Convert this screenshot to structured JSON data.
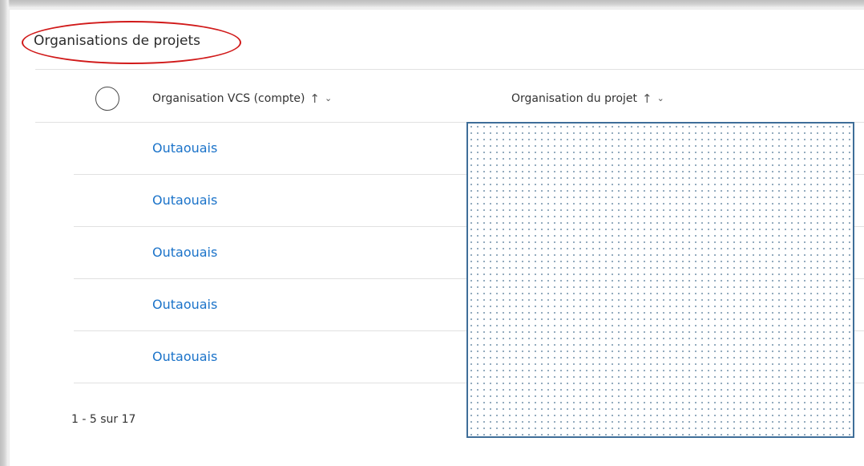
{
  "section": {
    "title": "Organisations de projets"
  },
  "table": {
    "columns": [
      {
        "label": "Organisation VCS (compte)",
        "sort_icon": "↑",
        "menu_icon": "⌄"
      },
      {
        "label": "Organisation du projet",
        "sort_icon": "↑",
        "menu_icon": "⌄"
      }
    ],
    "rows": [
      {
        "vcs_org": "Outaouais"
      },
      {
        "vcs_org": "Outaouais"
      },
      {
        "vcs_org": "Outaouais"
      },
      {
        "vcs_org": "Outaouais"
      },
      {
        "vcs_org": "Outaouais"
      }
    ]
  },
  "pagination": {
    "text": "1 - 5 sur 17"
  },
  "colors": {
    "link": "#1b73c9",
    "annotation": "#d11a1a",
    "redaction_border": "#3f6e99"
  }
}
